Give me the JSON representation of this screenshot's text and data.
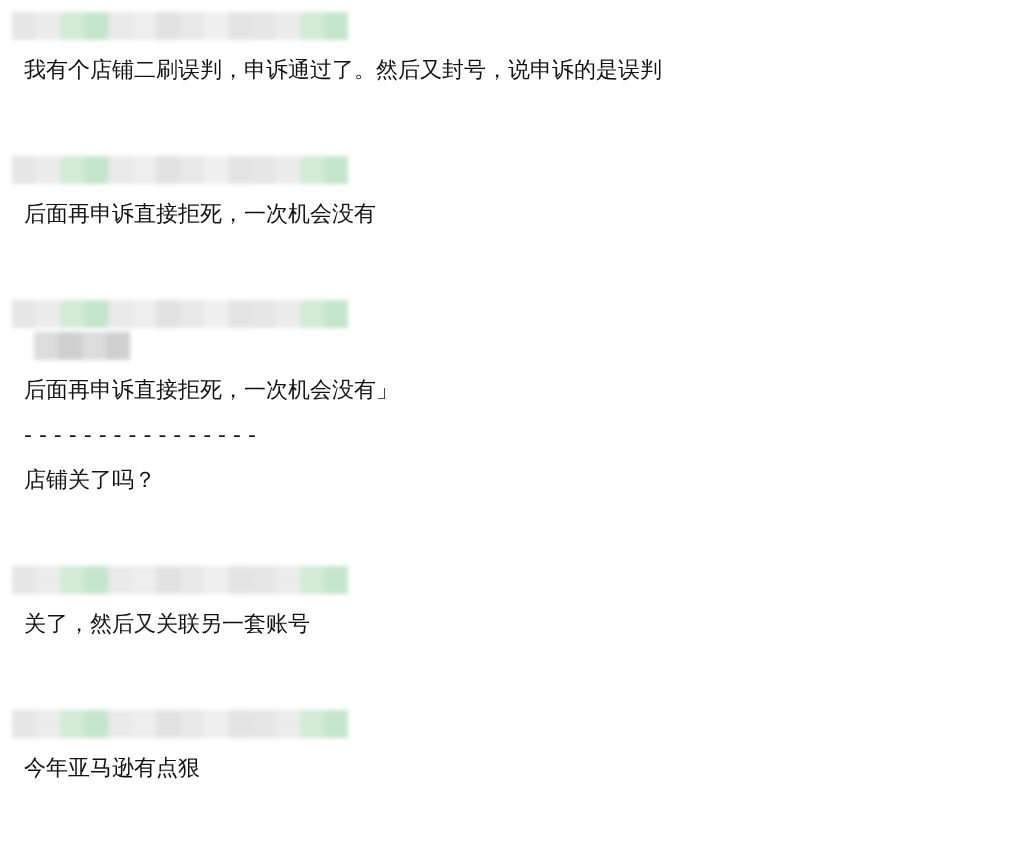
{
  "messages": [
    {
      "kind": "plain",
      "text": "我有个店铺二刷误判，申诉通过了。然后又封号，说申诉的是误判"
    },
    {
      "kind": "plain",
      "text": "后面再申诉直接拒死，一次机会没有"
    },
    {
      "kind": "quote",
      "quote": "后面再申诉直接拒死，一次机会没有」",
      "divider": "- - - - - - - - - - - - - - - -",
      "text": "店铺关了吗？"
    },
    {
      "kind": "plain",
      "text": "关了，然后又关联另一套账号"
    },
    {
      "kind": "plain",
      "text": "今年亚马逊有点狠"
    }
  ]
}
